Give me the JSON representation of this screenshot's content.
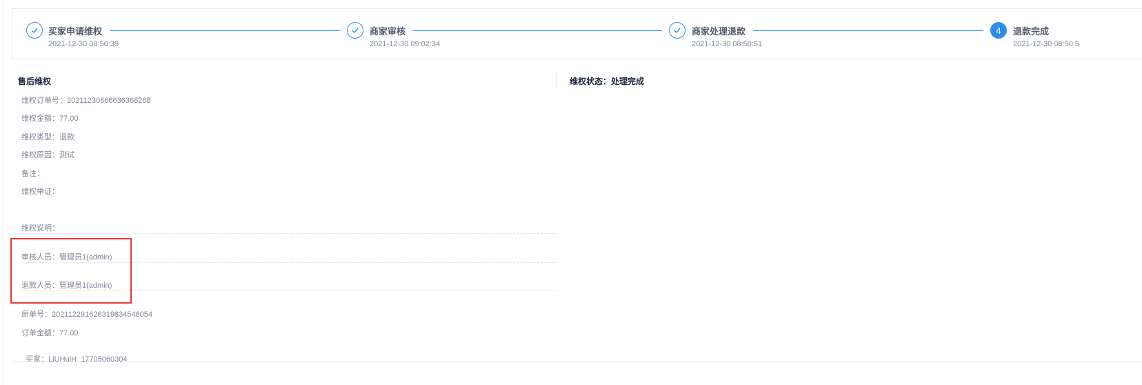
{
  "steps": [
    {
      "title": "买家申请维权",
      "time": "2021-12-30 08:50:39",
      "status": "done"
    },
    {
      "title": "商家审核",
      "time": "2021-12-30 09:02:34",
      "status": "done"
    },
    {
      "title": "商家处理退款",
      "time": "2021-12-30 08:50:51",
      "status": "done"
    },
    {
      "title": "退款完成",
      "time": "2021-12-30 08:50:5",
      "status": "current",
      "number": "4"
    }
  ],
  "section": {
    "title": "售后维权",
    "status_label": "维权状态：",
    "status_value": "处理完成"
  },
  "fields": {
    "order_no": {
      "label": "维权订单号：",
      "value": "20211230666636368288"
    },
    "amount": {
      "label": "维权金额：",
      "value": "77.00"
    },
    "type": {
      "label": "维权类型：",
      "value": "退款"
    },
    "reason": {
      "label": "维权原因：",
      "value": "测试"
    },
    "remark": {
      "label": "备注：",
      "value": ""
    },
    "evidence": {
      "label": "维权举证：",
      "value": ""
    },
    "description": {
      "label": "维权说明：",
      "value": ""
    },
    "reviewer": {
      "label": "审核人员：",
      "value": "管理员1(admin)"
    },
    "refunder": {
      "label": "退款人员：",
      "value": "管理员1(admin)"
    },
    "original_no": {
      "label": "原单号：",
      "value": "20211229162631983454805​4"
    },
    "order_amount": {
      "label": "订单金额：",
      "value": "77.00"
    },
    "buyer": {
      "label": "买家：",
      "value": "LiUHuiH  17705060304"
    }
  },
  "colors": {
    "accent": "#2d8cf0",
    "highlight": "#e53935"
  }
}
